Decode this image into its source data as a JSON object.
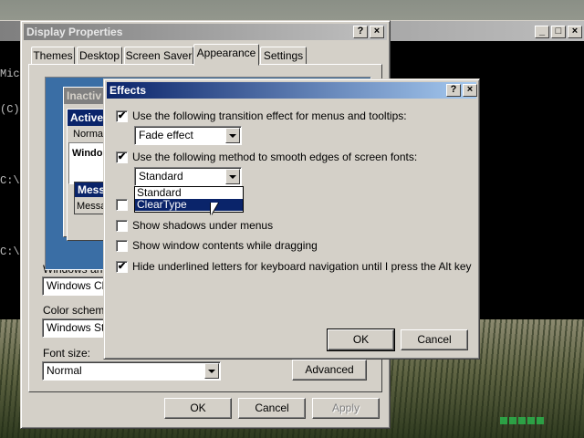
{
  "console": {
    "lines": [
      "Mic",
      "(C)",
      "",
      "C:\\",
      "",
      "C:\\"
    ]
  },
  "display_properties": {
    "title": "Display Properties",
    "tabs": [
      "Themes",
      "Desktop",
      "Screen Saver",
      "Appearance",
      "Settings"
    ],
    "active_tab": "Appearance",
    "preview": {
      "inactive_title": "Inactiv",
      "active_title": "Active",
      "normal_text": "Normal",
      "window_text": "Windo",
      "message_title": "Mess",
      "message_text": "Messa"
    },
    "windows_and_buttons_label": "Windows and",
    "windows_and_buttons_value": "Windows Cla",
    "color_scheme_label": "Color scheme:",
    "color_scheme_value": "Windows Sta",
    "font_size_label": "Font size:",
    "font_size_value": "Normal",
    "advanced_label": "Advanced",
    "ok_label": "OK",
    "cancel_label": "Cancel",
    "apply_label": "Apply"
  },
  "effects": {
    "title": "Effects",
    "help_glyph": "?",
    "close_glyph": "×",
    "options": [
      {
        "label": "Use the following transition effect for menus and tooltips:",
        "checked": true
      },
      {
        "label": "Use the following method to smooth edges of screen fonts:",
        "checked": true
      },
      {
        "label": "",
        "checked": false
      },
      {
        "label": "Show shadows under menus",
        "checked": false
      },
      {
        "label": "Show window contents while dragging",
        "checked": false
      },
      {
        "label": "Hide underlined letters for keyboard navigation until I press the Alt key",
        "checked": true
      }
    ],
    "transition_value": "Fade effect",
    "smoothing_value": "Standard",
    "smoothing_options": [
      "Standard",
      "ClearType"
    ],
    "smoothing_highlighted": "ClearType",
    "ok_label": "OK",
    "cancel_label": "Cancel"
  }
}
